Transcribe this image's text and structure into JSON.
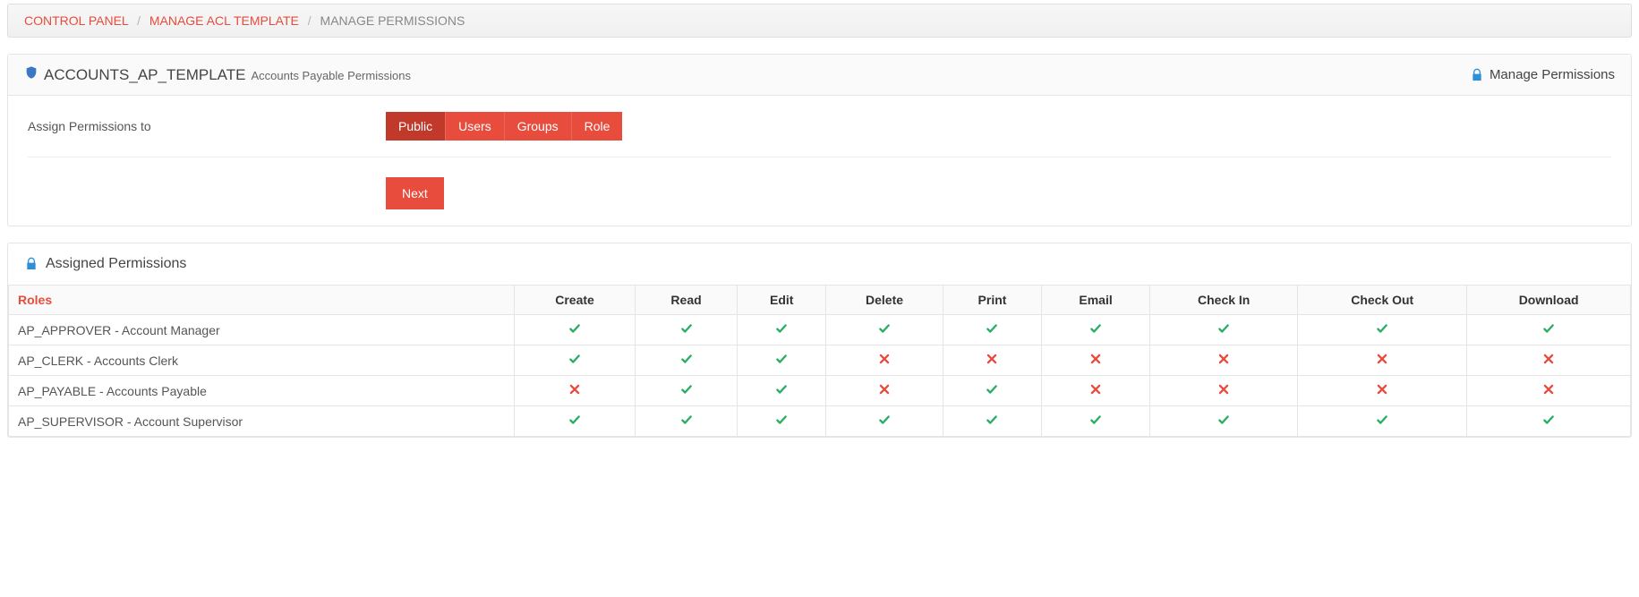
{
  "breadcrumb": {
    "items": [
      {
        "label": "CONTROL PANEL",
        "link": true
      },
      {
        "label": "MANAGE ACL TEMPLATE",
        "link": true
      },
      {
        "label": "MANAGE PERMISSIONS",
        "link": false
      }
    ]
  },
  "header": {
    "template_name": "ACCOUNTS_AP_TEMPLATE",
    "description": "Accounts Payable Permissions",
    "right_label": "Manage Permissions"
  },
  "assign": {
    "label": "Assign Permissions to",
    "tabs": [
      "Public",
      "Users",
      "Groups",
      "Role"
    ],
    "active_index": 0,
    "next_label": "Next"
  },
  "assigned_section": {
    "title": "Assigned Permissions"
  },
  "table": {
    "role_header": "Roles",
    "columns": [
      "Create",
      "Read",
      "Edit",
      "Delete",
      "Print",
      "Email",
      "Check In",
      "Check Out",
      "Download"
    ],
    "rows": [
      {
        "role": "AP_APPROVER - Account Manager",
        "perms": [
          true,
          true,
          true,
          true,
          true,
          true,
          true,
          true,
          true
        ]
      },
      {
        "role": "AP_CLERK - Accounts Clerk",
        "perms": [
          true,
          true,
          true,
          false,
          false,
          false,
          false,
          false,
          false
        ]
      },
      {
        "role": "AP_PAYABLE - Accounts Payable",
        "perms": [
          false,
          true,
          true,
          false,
          true,
          false,
          false,
          false,
          false
        ]
      },
      {
        "role": "AP_SUPERVISOR - Account Supervisor",
        "perms": [
          true,
          true,
          true,
          true,
          true,
          true,
          true,
          true,
          true
        ]
      }
    ]
  }
}
